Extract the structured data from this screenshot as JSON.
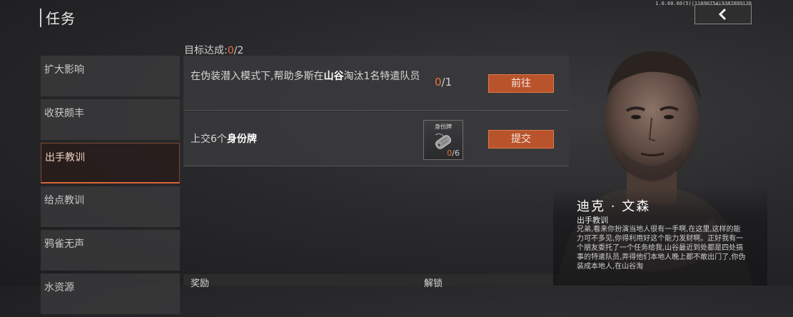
{
  "header": {
    "title": "任务",
    "version": "1.0.60.60(5)|11090754|9382899120",
    "back_icon": "chevron-left-icon"
  },
  "sidebar": {
    "items": [
      {
        "label": "扩大影响",
        "active": false
      },
      {
        "label": "收获颇丰",
        "active": false
      },
      {
        "label": "出手教训",
        "active": true
      },
      {
        "label": "给点教训",
        "active": false
      },
      {
        "label": "鸦雀无声",
        "active": false
      },
      {
        "label": "水资源",
        "active": false
      }
    ]
  },
  "goal": {
    "label": "目标达成:",
    "current": "0",
    "total": "/2"
  },
  "tasks": [
    {
      "desc_pre": "在伪装潜入模式下,帮助多斯在",
      "desc_hl": "山谷",
      "desc_post": "淘汰1名特遣队员",
      "progress_current": "0",
      "progress_total": "/1",
      "button": "前往"
    },
    {
      "desc_pre": "上交6个",
      "desc_hl": "身份牌",
      "item_name": "身份牌",
      "item_icon": "dog-tag-icon",
      "item_current": "0",
      "item_total": "/6",
      "button": "提交"
    }
  ],
  "bottom": {
    "reward_label": "奖励",
    "unlock_label": "解锁"
  },
  "npc": {
    "name": "迪克 · 文森",
    "role": "出手教训",
    "dialog": "兄弟,看来你扮演当地人很有一手啊,在这里,这样的能力可不多见,你得利用好这个能力发财啊。正好我有一个朋友委托了一个任务给我,山谷最近到处都是四处搞事的特遣队员,弄得他们本地人晚上都不敢出门了,你伪装成本地人,在山谷淘"
  },
  "colors": {
    "accent": "#e9713b",
    "button": "#b8532c"
  }
}
